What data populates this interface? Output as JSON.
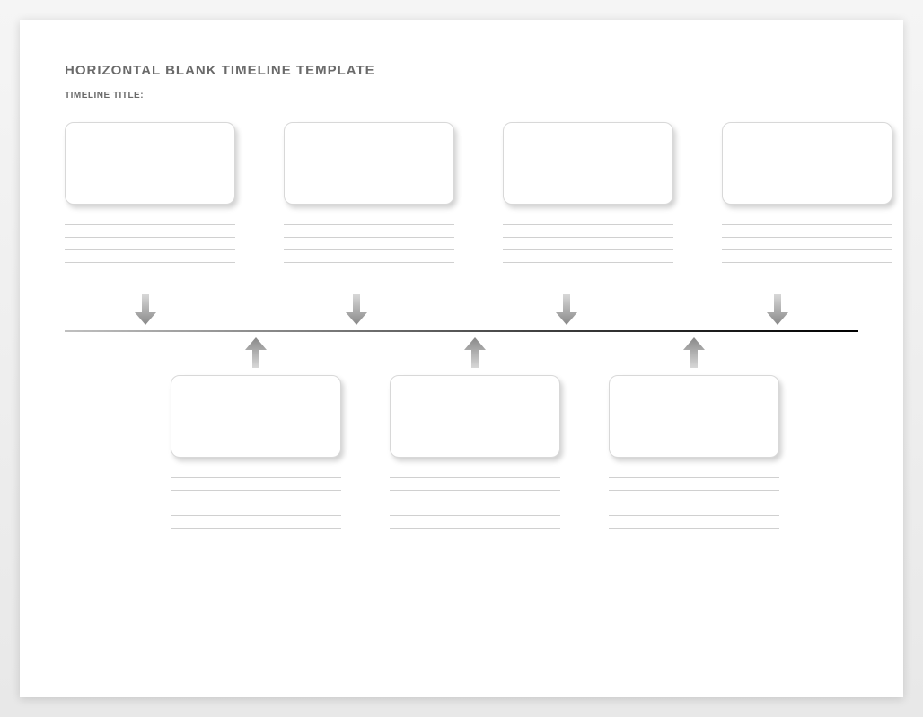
{
  "header": {
    "title": "HORIZONTAL BLANK TIMELINE TEMPLATE",
    "subtitle": "TIMELINE TITLE:"
  },
  "top_events": [
    {
      "card": "",
      "lines": [
        "",
        "",
        "",
        "",
        ""
      ]
    },
    {
      "card": "",
      "lines": [
        "",
        "",
        "",
        "",
        ""
      ]
    },
    {
      "card": "",
      "lines": [
        "",
        "",
        "",
        "",
        ""
      ]
    },
    {
      "card": "",
      "lines": [
        "",
        "",
        "",
        "",
        ""
      ]
    }
  ],
  "bottom_events": [
    {
      "card": "",
      "lines": [
        "",
        "",
        "",
        "",
        ""
      ]
    },
    {
      "card": "",
      "lines": [
        "",
        "",
        "",
        "",
        ""
      ]
    },
    {
      "card": "",
      "lines": [
        "",
        "",
        "",
        "",
        ""
      ]
    }
  ]
}
